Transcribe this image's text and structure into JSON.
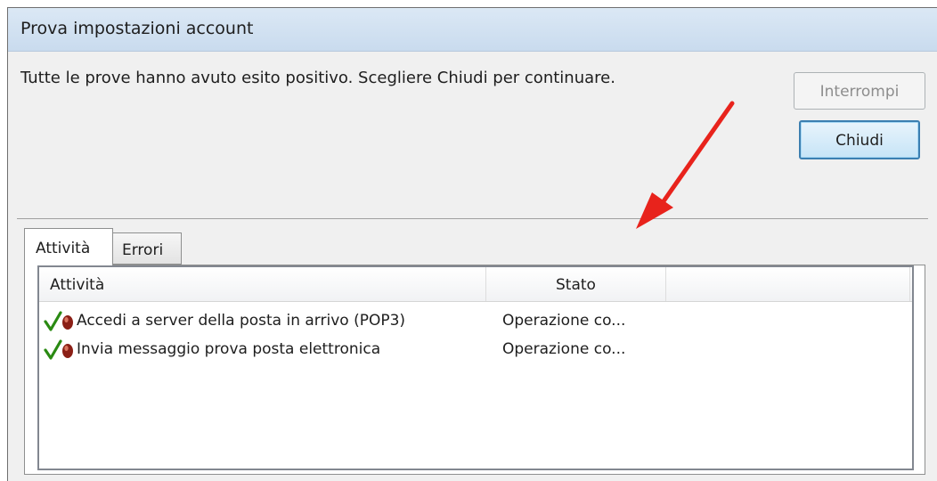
{
  "window": {
    "title": "Prova impostazioni account"
  },
  "message": "Tutte le prove hanno avuto esito positivo. Scegliere Chiudi per continuare.",
  "buttons": {
    "stop_label": "Interrompi",
    "close_label": "Chiudi"
  },
  "tabs": [
    {
      "label": "Attività",
      "selected": true
    },
    {
      "label": "Errori",
      "selected": false
    }
  ],
  "table": {
    "columns": [
      "Attività",
      "Stato"
    ],
    "rows": [
      {
        "task": "Accedi a server della posta in arrivo (POP3)",
        "status": "Operazione co...",
        "icon": "check-icon"
      },
      {
        "task": "Invia messaggio prova posta elettronica",
        "status": "Operazione co...",
        "icon": "check-icon"
      }
    ]
  },
  "colors": {
    "accent": "#3c7fb1",
    "arrow": "#e8231c",
    "check": "#2a8a12"
  }
}
